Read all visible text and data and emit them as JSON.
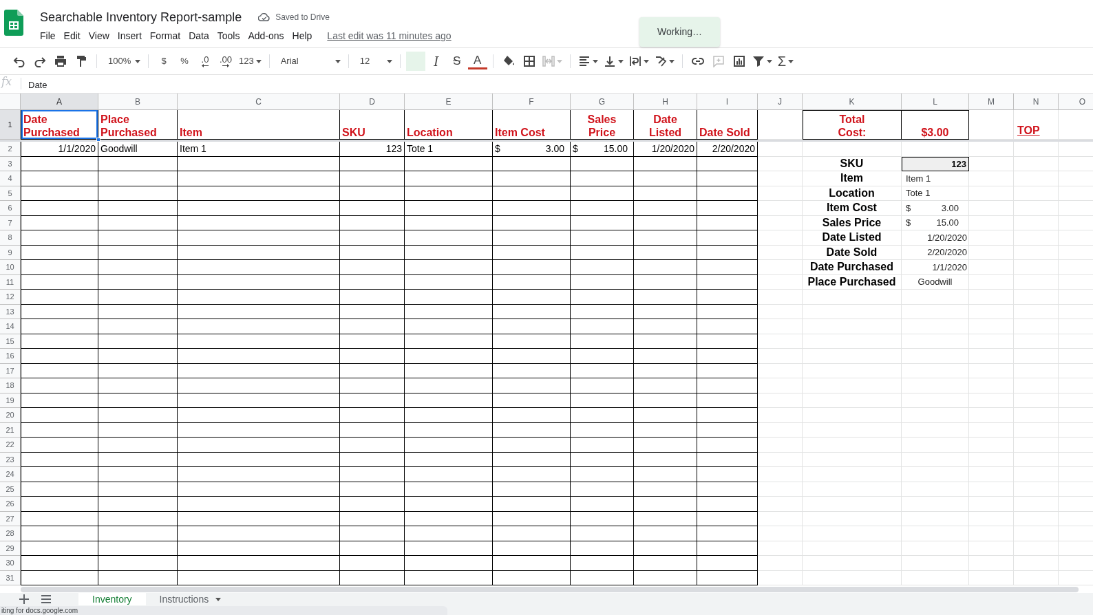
{
  "document": {
    "title": "Searchable Inventory Report-sample",
    "save_status": "Saved to Drive",
    "last_edit": "Last edit was 11 minutes ago"
  },
  "menus": [
    "File",
    "Edit",
    "View",
    "Insert",
    "Format",
    "Data",
    "Tools",
    "Add-ons",
    "Help"
  ],
  "toast": "Working…",
  "toolbar": [
    {
      "kind": "icon",
      "menu": false,
      "disabled": false
    },
    {
      "kind": "icon",
      "menu": false,
      "disabled": false
    },
    {
      "kind": "icon",
      "menu": false,
      "disabled": false
    },
    {
      "kind": "icon",
      "menu": false,
      "disabled": false
    },
    {
      "kind": "separator"
    },
    {
      "kind": "dropdown",
      "text": "100%"
    },
    {
      "kind": "separator"
    },
    {
      "kind": "text",
      "text": "$"
    },
    {
      "kind": "text",
      "text": "%"
    },
    {
      "kind": "decimal-less",
      "text": ".0"
    },
    {
      "kind": "decimal-more",
      "text": ".00"
    },
    {
      "kind": "text-menu",
      "text": "123"
    },
    {
      "kind": "separator"
    },
    {
      "kind": "dropdown",
      "text": "Arial"
    },
    {
      "kind": "separator"
    },
    {
      "kind": "dropdown",
      "text": "12"
    },
    {
      "kind": "separator"
    },
    {
      "kind": "toggle",
      "selected": true
    },
    {
      "kind": "italic",
      "text": "I"
    },
    {
      "kind": "strike",
      "text": "S"
    },
    {
      "kind": "font-color",
      "text": "A"
    },
    {
      "kind": "separator"
    },
    {
      "kind": "icon",
      "menu": false,
      "disabled": false
    },
    {
      "kind": "icon",
      "menu": false,
      "disabled": false
    },
    {
      "kind": "icon",
      "menu": true,
      "disabled": true
    },
    {
      "kind": "separator"
    },
    {
      "kind": "icon",
      "menu": true,
      "disabled": false
    },
    {
      "kind": "icon",
      "menu": true,
      "disabled": false
    },
    {
      "kind": "icon",
      "menu": true,
      "disabled": false
    },
    {
      "kind": "icon",
      "menu": true,
      "disabled": false
    },
    {
      "kind": "separator"
    },
    {
      "kind": "icon",
      "menu": false,
      "disabled": false
    },
    {
      "kind": "icon",
      "menu": false,
      "disabled": true
    },
    {
      "kind": "icon",
      "menu": false,
      "disabled": false
    },
    {
      "kind": "icon",
      "menu": true,
      "disabled": false
    },
    {
      "kind": "text-menu",
      "text": "Σ"
    }
  ],
  "formula_bar": {
    "label": "fx",
    "content": "Date"
  },
  "sheet": {
    "columns": [
      "A",
      "B",
      "C",
      "D",
      "E",
      "F",
      "G",
      "H",
      "I",
      "J",
      "K",
      "L",
      "M",
      "N",
      "O"
    ],
    "row_numbers": [
      "1",
      "2",
      "3",
      "4",
      "5",
      "6",
      "7",
      "8",
      "9",
      "10",
      "11",
      "12",
      "13",
      "14",
      "15",
      "16",
      "17",
      "18",
      "19",
      "20",
      "21",
      "22",
      "23",
      "24",
      "25",
      "26",
      "27",
      "28",
      "29",
      "30",
      "31"
    ],
    "headers": [
      {
        "text": "Date\nPurchased",
        "kind": "left",
        "selected": true
      },
      {
        "text": "Place\nPurchased",
        "kind": "left",
        "selected": false
      },
      {
        "text": "Item",
        "kind": "left",
        "selected": false
      },
      {
        "text": "SKU",
        "kind": "left",
        "selected": false
      },
      {
        "text": "Location",
        "kind": "left",
        "selected": false
      },
      {
        "text": "Item Cost",
        "kind": "left",
        "selected": false
      },
      {
        "text": "Sales\nPrice",
        "kind": "centered",
        "selected": false
      },
      {
        "text": "Date\nListed",
        "kind": "centered",
        "selected": false
      },
      {
        "text": "Date Sold",
        "kind": "left",
        "selected": false
      }
    ],
    "records": [
      {
        "cells": [
          {
            "kind": "date",
            "text": "1/1/2020"
          },
          {
            "kind": "text",
            "text": "Goodwill"
          },
          {
            "kind": "text",
            "text": "Item 1"
          },
          {
            "kind": "number",
            "text": "123"
          },
          {
            "kind": "text",
            "text": "Tote 1"
          },
          {
            "kind": "currency",
            "symbol": "$",
            "text": "3.00"
          },
          {
            "kind": "currency",
            "symbol": "$",
            "text": "15.00"
          },
          {
            "kind": "date",
            "text": "1/20/2020"
          },
          {
            "kind": "date",
            "text": "2/20/2020"
          }
        ]
      }
    ],
    "total": {
      "label": "Total\nCost:",
      "value": "$3.00"
    },
    "top_link": "TOP",
    "lookup": {
      "sku_label": "SKU",
      "sku_value": "123",
      "fields": [
        {
          "label": "Item",
          "kind": "text",
          "value": "Item 1"
        },
        {
          "label": "Location",
          "kind": "text",
          "value": "Tote 1"
        },
        {
          "label": "Item Cost",
          "kind": "currency",
          "symbol": "$",
          "value": "3.00"
        },
        {
          "label": "Sales Price",
          "kind": "currency",
          "symbol": "$",
          "value": "15.00"
        },
        {
          "label": "Date Listed",
          "kind": "date",
          "value": "1/20/2020"
        },
        {
          "label": "Date Sold",
          "kind": "date",
          "value": "2/20/2020"
        },
        {
          "label": "Date Purchased",
          "kind": "date",
          "value": "1/1/2020"
        },
        {
          "label": "Place Purchased",
          "kind": "place",
          "value": "Goodwill"
        }
      ]
    }
  },
  "sheet_tabs": [
    {
      "label": "Inventory",
      "selected": true,
      "menu": false
    },
    {
      "label": "Instructions",
      "selected": false,
      "menu": true
    }
  ],
  "status": "iting for docs.google.com"
}
